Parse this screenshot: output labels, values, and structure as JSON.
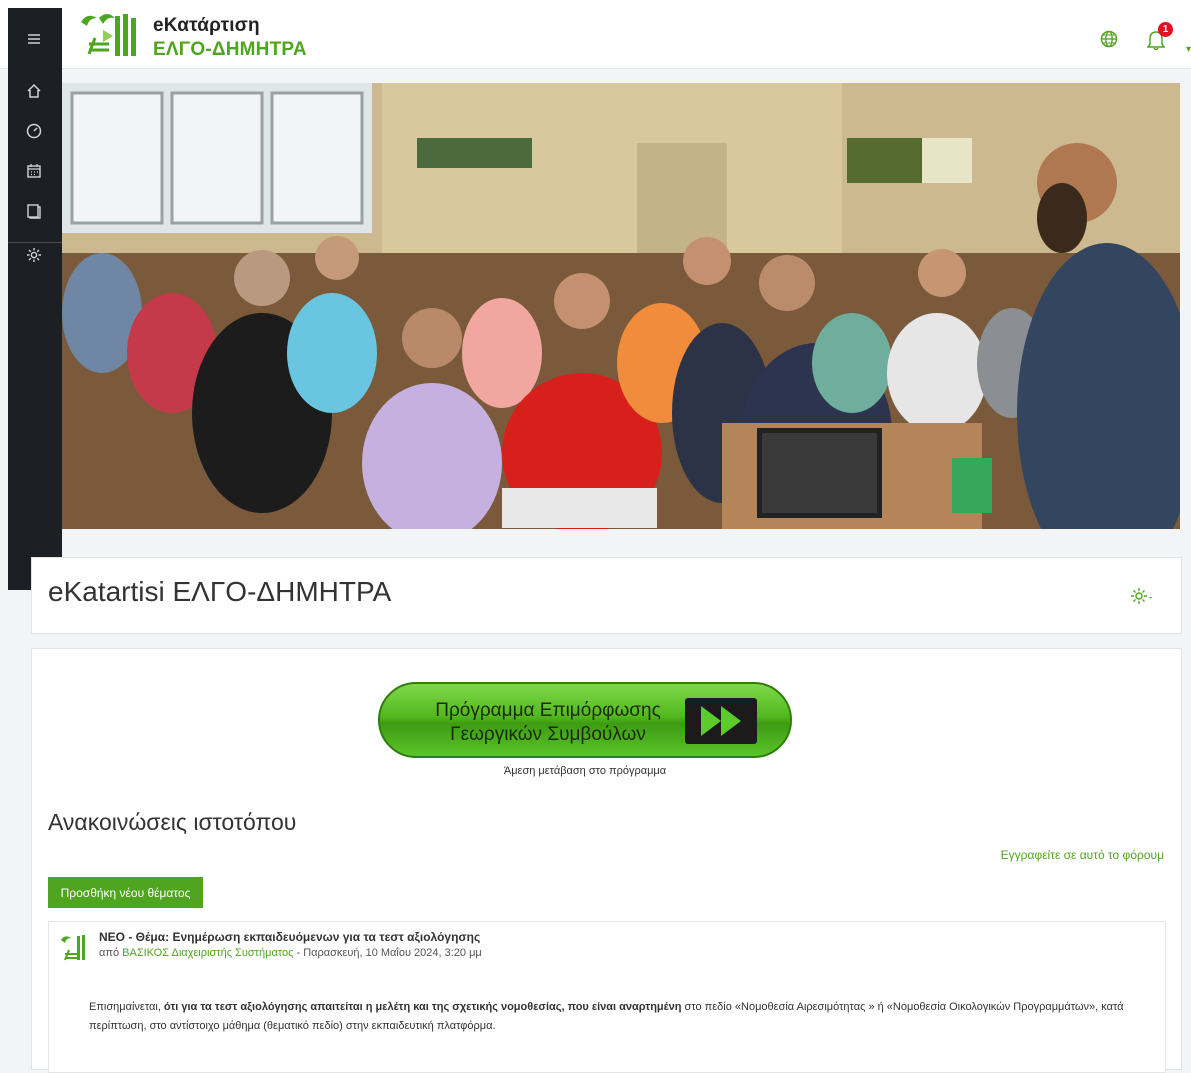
{
  "header": {
    "logo_line1": "eΚατάρτιση",
    "logo_line2": "ΕΛΓΟ-ΔΗΜΗΤΡΑ",
    "notification_count": "1",
    "icons": [
      "globe-icon",
      "bell-icon"
    ]
  },
  "sidenav": {
    "icons": [
      "menu-icon",
      "home-icon",
      "dashboard-icon",
      "calendar-icon",
      "courses-icon",
      "settings-icon"
    ]
  },
  "site": {
    "title": "eKatartisi ΕΛΓΟ-ΔΗΜΗΤΡΑ"
  },
  "promo": {
    "line1": "Πρόγραμμα Επιμόρφωσης",
    "line2": "Γεωργικών Συμβούλων",
    "caption": "Άμεση μετάβαση στο πρόγραμμα"
  },
  "news": {
    "heading": "Ανακοινώσεις ιστοτόπου",
    "subscribe_label": "Εγγραφείτε σε αυτό το φόρουμ",
    "add_topic_label": "Προσθήκη νέου θέματος"
  },
  "post": {
    "subject": "ΝΕΟ - Θέμα: Ενημέρωση εκπαιδευόμενων για τα τεστ αξιολόγησης",
    "by_prefix": "από",
    "author": "ΒΑΣΙΚΟΣ Διαχειριστής Συστήματος",
    "date_sep": " - ",
    "date": "Παρασκευή, 10 Μαΐου 2024, 3:20 μμ",
    "body_lead": "Επισημαίνεται,",
    "body_bold": " ότι για τα τεστ αξιολόγησης απαιτείται η μελέτη και της σχετικής νομοθεσίας, που είναι αναρτημένη",
    "body_rest": " στο πεδίο «Νομοθεσία Αιρεσιμότητας » ή «Νομοθεσία Οικολογικών Προγραμμάτων», κατά περίπτωση, στο αντίστοιχο μάθημα (θεματικό πεδίο) στην εκπαιδευτική πλατφόρμα."
  },
  "colors": {
    "brand_green": "#4fa51f",
    "drawer_bg": "#1c2025",
    "badge_red": "#e3101e"
  }
}
